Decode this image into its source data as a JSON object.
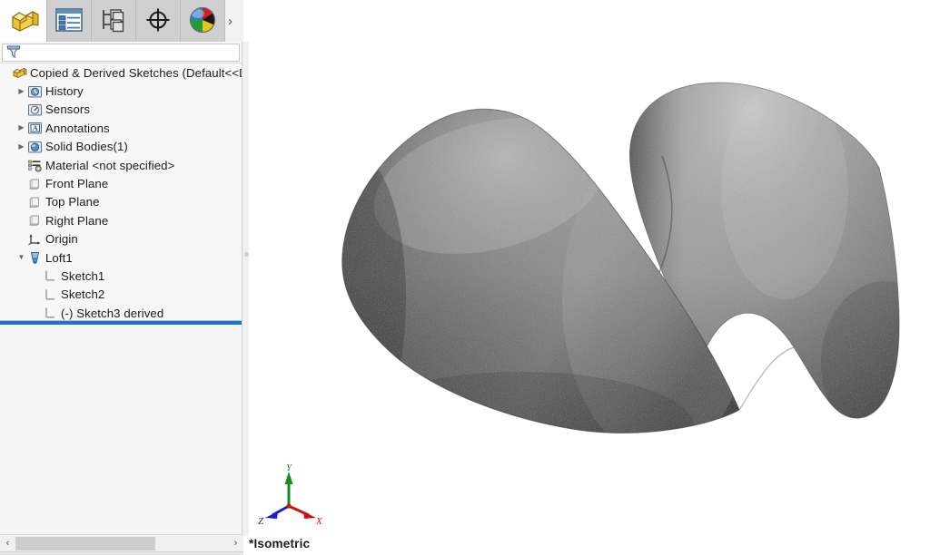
{
  "app": {
    "view_label": "*Isometric"
  },
  "tabs": [
    {
      "name": "feature-manager",
      "icon": "part-cube-icon",
      "title": "FeatureManager Design Tree",
      "active": true
    },
    {
      "name": "property-manager",
      "icon": "property-list-icon",
      "title": "PropertyManager",
      "active": false
    },
    {
      "name": "configuration-manager",
      "icon": "configuration-tree-icon",
      "title": "ConfigurationManager",
      "active": false
    },
    {
      "name": "dimxpert-manager",
      "icon": "crosshair-target-icon",
      "title": "DimXpertManager",
      "active": false
    },
    {
      "name": "display-manager",
      "icon": "color-sphere-icon",
      "title": "DisplayManager",
      "active": false
    }
  ],
  "tab_overflow_label": "›",
  "filter": {
    "icon": "filter-funnel-icon",
    "value": "",
    "placeholder": ""
  },
  "tree": {
    "root": {
      "label": "Copied & Derived Sketches  (Default<<Defa",
      "icon": "part-document-icon",
      "indent": 0
    },
    "items": [
      {
        "label": "History",
        "icon": "history-folder-icon",
        "indent": 1,
        "arrow": "collapsed",
        "selected": false
      },
      {
        "label": "Sensors",
        "icon": "sensors-folder-icon",
        "indent": 1,
        "arrow": "none",
        "selected": false
      },
      {
        "label": "Annotations",
        "icon": "annotations-folder-icon",
        "indent": 1,
        "arrow": "collapsed",
        "selected": false
      },
      {
        "label": "Solid Bodies(1)",
        "icon": "solid-bodies-folder-icon",
        "indent": 1,
        "arrow": "collapsed",
        "selected": false
      },
      {
        "label": "Material <not specified>",
        "icon": "material-icon",
        "indent": 1,
        "arrow": "none",
        "selected": false
      },
      {
        "label": "Front Plane",
        "icon": "plane-icon",
        "indent": 1,
        "arrow": "none",
        "selected": false
      },
      {
        "label": "Top Plane",
        "icon": "plane-icon",
        "indent": 1,
        "arrow": "none",
        "selected": false
      },
      {
        "label": "Right Plane",
        "icon": "plane-icon",
        "indent": 1,
        "arrow": "none",
        "selected": false
      },
      {
        "label": "Origin",
        "icon": "origin-axes-icon",
        "indent": 1,
        "arrow": "none",
        "selected": false
      },
      {
        "label": "Loft1",
        "icon": "loft-feature-icon",
        "indent": 1,
        "arrow": "expanded",
        "selected": false
      },
      {
        "label": "Sketch1",
        "icon": "sketch-icon",
        "indent": 2,
        "arrow": "none",
        "selected": false
      },
      {
        "label": "Sketch2",
        "icon": "sketch-icon",
        "indent": 2,
        "arrow": "none",
        "selected": false
      },
      {
        "label": "(-) Sketch3 derived",
        "icon": "sketch-icon",
        "indent": 2,
        "arrow": "none",
        "selected": false
      }
    ]
  },
  "rollback_bar": {
    "color": "#1b75d0"
  },
  "scrollbar": {
    "left_arrow": "‹",
    "right_arrow": "›",
    "thumb_position_pct": 0,
    "thumb_width_pct": 66
  },
  "triad": {
    "x_label": "X",
    "y_label": "Y",
    "z_label": "Z",
    "x_color": "#cc1111",
    "y_color": "#0e8f1e",
    "z_color": "#1a1ad0"
  },
  "model": {
    "name": "lofted-solid-body",
    "base_color": "#6f6f6f",
    "highlight_color": "#b9b9b9",
    "shadow_color": "#3e3e3e"
  }
}
